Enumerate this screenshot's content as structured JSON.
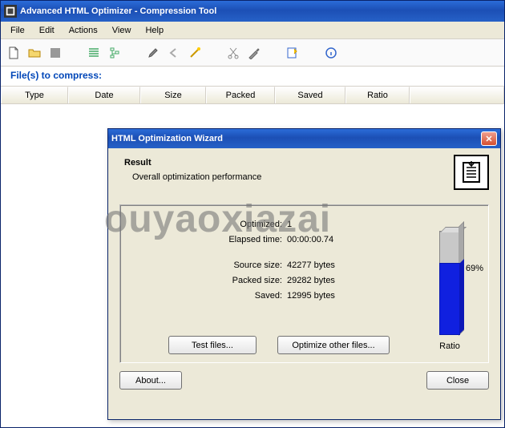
{
  "window": {
    "title": "Advanced HTML Optimizer - Compression Tool"
  },
  "menubar": {
    "file": "File",
    "edit": "Edit",
    "actions": "Actions",
    "view": "View",
    "help": "Help"
  },
  "section": {
    "files_to_compress": "File(s) to compress:"
  },
  "grid": {
    "type": "Type",
    "date": "Date",
    "size": "Size",
    "packed": "Packed",
    "saved": "Saved",
    "ratio": "Ratio"
  },
  "wizard": {
    "title": "HTML Optimization Wizard",
    "heading": "Result",
    "subheading": "Overall optimization performance",
    "stats": {
      "optimized_label": "Optimized:",
      "optimized_value": "1",
      "elapsed_label": "Elapsed time:",
      "elapsed_value": "00:00:00.74",
      "source_label": "Source size:",
      "source_value": "42277 bytes",
      "packed_label": "Packed size:",
      "packed_value": "29282 bytes",
      "saved_label": "Saved:",
      "saved_value": "12995 bytes"
    },
    "chart_label": "Ratio",
    "buttons": {
      "test_files": "Test files...",
      "optimize_other": "Optimize other files...",
      "about": "About...",
      "close": "Close"
    }
  },
  "watermark": "ouyaoxiazai",
  "chart_data": {
    "type": "bar",
    "categories": [
      "Ratio"
    ],
    "values": [
      69
    ],
    "title": "Ratio",
    "ylabel": "%",
    "ylim": [
      0,
      100
    ],
    "value_label": "69%"
  }
}
